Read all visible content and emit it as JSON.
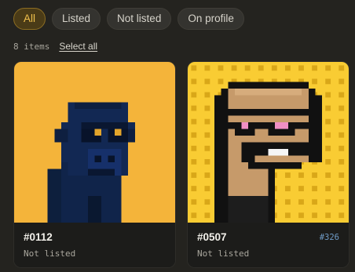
{
  "filters": {
    "tabs": [
      {
        "label": "All",
        "active": true
      },
      {
        "label": "Listed",
        "active": false
      },
      {
        "label": "Not listed",
        "active": false
      },
      {
        "label": "On profile",
        "active": false
      }
    ]
  },
  "toolbar": {
    "item_count": "8 items",
    "select_all": "Select all"
  },
  "items": [
    {
      "title": "#0112",
      "status": "Not listed",
      "rank": "",
      "background": "#f4b43a",
      "art": "ape-icon"
    },
    {
      "title": "#0507",
      "status": "Not listed",
      "rank": "#326",
      "background": "#f9cc33",
      "art": "punk-icon"
    }
  ],
  "colors": {
    "accent": "#f2c14d",
    "rank": "#6f9bc6",
    "page_background": "#24231f"
  }
}
